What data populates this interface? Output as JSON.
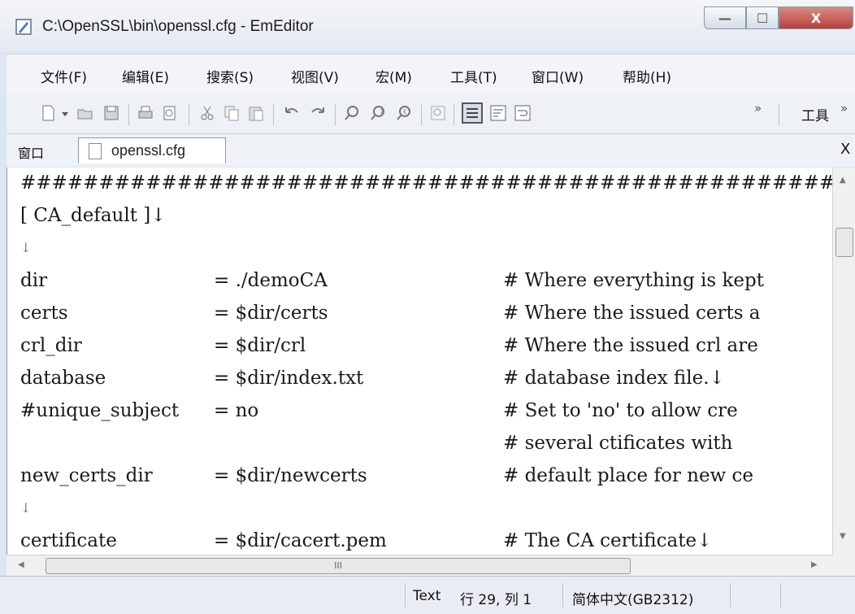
{
  "window": {
    "title": "C:\\OpenSSL\\bin\\openssl.cfg - EmEditor",
    "min_label": "—",
    "max_label": "☐",
    "close_label": "X"
  },
  "menu": [
    {
      "label": "文件(F)"
    },
    {
      "label": "编辑(E)"
    },
    {
      "label": "搜索(S)"
    },
    {
      "label": "视图(V)"
    },
    {
      "label": "宏(M)"
    },
    {
      "label": "工具(T)"
    },
    {
      "label": "窗口(W)"
    },
    {
      "label": "帮助(H)"
    }
  ],
  "toolbar": {
    "overflow_label": "»",
    "tools_label": "工具",
    "tools_overflow_label": "»",
    "icons": [
      "new-file-icon",
      "dropdown-arrow-icon",
      "open-folder-icon",
      "save-icon",
      "print-icon",
      "print-preview-icon",
      "cut-icon",
      "copy-icon",
      "paste-icon",
      "undo-icon",
      "redo-icon",
      "find-icon",
      "find-next-icon",
      "find-previous-icon",
      "clear-highlight-icon",
      "view-mode-icon",
      "wrap-icon",
      "wrap-window-icon"
    ]
  },
  "tabs": {
    "window_label": "窗口",
    "active_tab": "openssl.cfg",
    "close_label": "X"
  },
  "editor": {
    "lines": [
      {
        "name": "",
        "value": "",
        "comment": "",
        "full": "####################################################################"
      },
      {
        "name": "",
        "value": "",
        "comment": "",
        "full": "[ CA_default ]↓"
      },
      {
        "name": "",
        "value": "",
        "comment": "",
        "full": "↓"
      },
      {
        "name": "dir",
        "value": "= ./demoCA",
        "comment": "# Where everything is kept",
        "full": ""
      },
      {
        "name": "certs",
        "value": "= $dir/certs",
        "comment": "# Where the issued certs a",
        "full": ""
      },
      {
        "name": "crl_dir",
        "value": "= $dir/crl",
        "comment": "# Where the issued crl are",
        "full": ""
      },
      {
        "name": "database",
        "value": "= $dir/index.txt",
        "comment": "# database index file.↓",
        "full": ""
      },
      {
        "name": "#unique_subject",
        "value": "= no",
        "comment": "# Set to 'no' to allow cre",
        "full": ""
      },
      {
        "name": "",
        "value": "",
        "comment": "# several ctificates with",
        "full": ""
      },
      {
        "name": "new_certs_dir",
        "value": "= $dir/newcerts",
        "comment": "# default place for new ce",
        "full": ""
      },
      {
        "name": "",
        "value": "",
        "comment": "",
        "full": "↓"
      },
      {
        "name": "certificate",
        "value": "= $dir/cacert.pem",
        "comment": "# The CA certificate↓",
        "full": ""
      }
    ]
  },
  "scrollbars": {
    "up_arrow": "▲",
    "down_arrow": "▼",
    "left_arrow": "◀",
    "right_arrow": "▶",
    "h_thumb_grip": "III"
  },
  "status": {
    "mode": "Text",
    "position": "行 29, 列 1",
    "encoding": "简体中文(GB2312)"
  }
}
